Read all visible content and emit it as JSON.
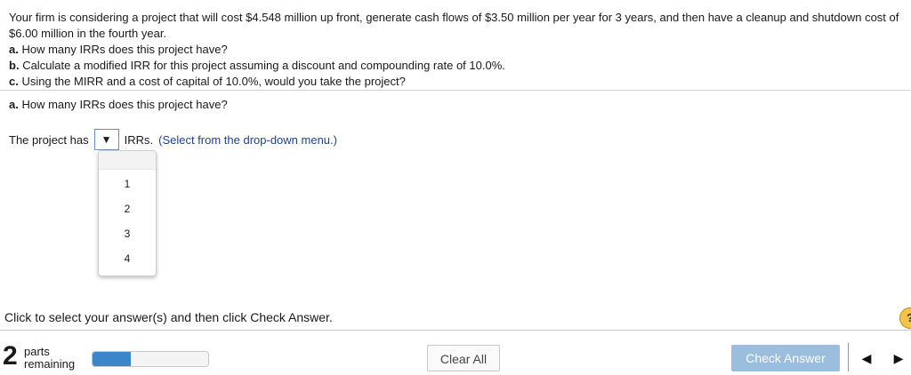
{
  "problem": {
    "intro": "Your firm is considering a project that will cost $4.548 million up front, generate cash flows of $3.50 million per year for 3 years, and then have a cleanup and shutdown cost of $6.00 million in the fourth year.",
    "part_a_label": "a.",
    "part_a_text": "How many IRRs does this project have?",
    "part_b_label": "b.",
    "part_b_text": "Calculate a modified IRR for this project assuming a discount and compounding rate of 10.0%.",
    "part_c_label": "c.",
    "part_c_text": "Using the MIRR and a cost of capital of 10.0%, would you take the project?"
  },
  "question": {
    "label": "a.",
    "text": "How many IRRs does this project have?"
  },
  "answer_sentence": {
    "prefix": "The project has",
    "select_arrow": "▼",
    "suffix": "IRRs.",
    "hint": "(Select from the drop-down menu.)"
  },
  "dropdown": {
    "options": [
      "1",
      "2",
      "3",
      "4"
    ]
  },
  "footer": {
    "instruction": "Click to select your answer(s) and then click Check Answer.",
    "help_symbol": "?",
    "parts_count": "2",
    "parts_line1": "parts",
    "parts_line2": "remaining",
    "progress_fraction": 0.33,
    "clear_label": "Clear All",
    "check_label": "Check Answer",
    "prev_symbol": "◀",
    "next_symbol": "▶"
  },
  "colors": {
    "hint": "#1f3f9e",
    "progress": "#3a86c8",
    "check_button": "#9bbede"
  }
}
